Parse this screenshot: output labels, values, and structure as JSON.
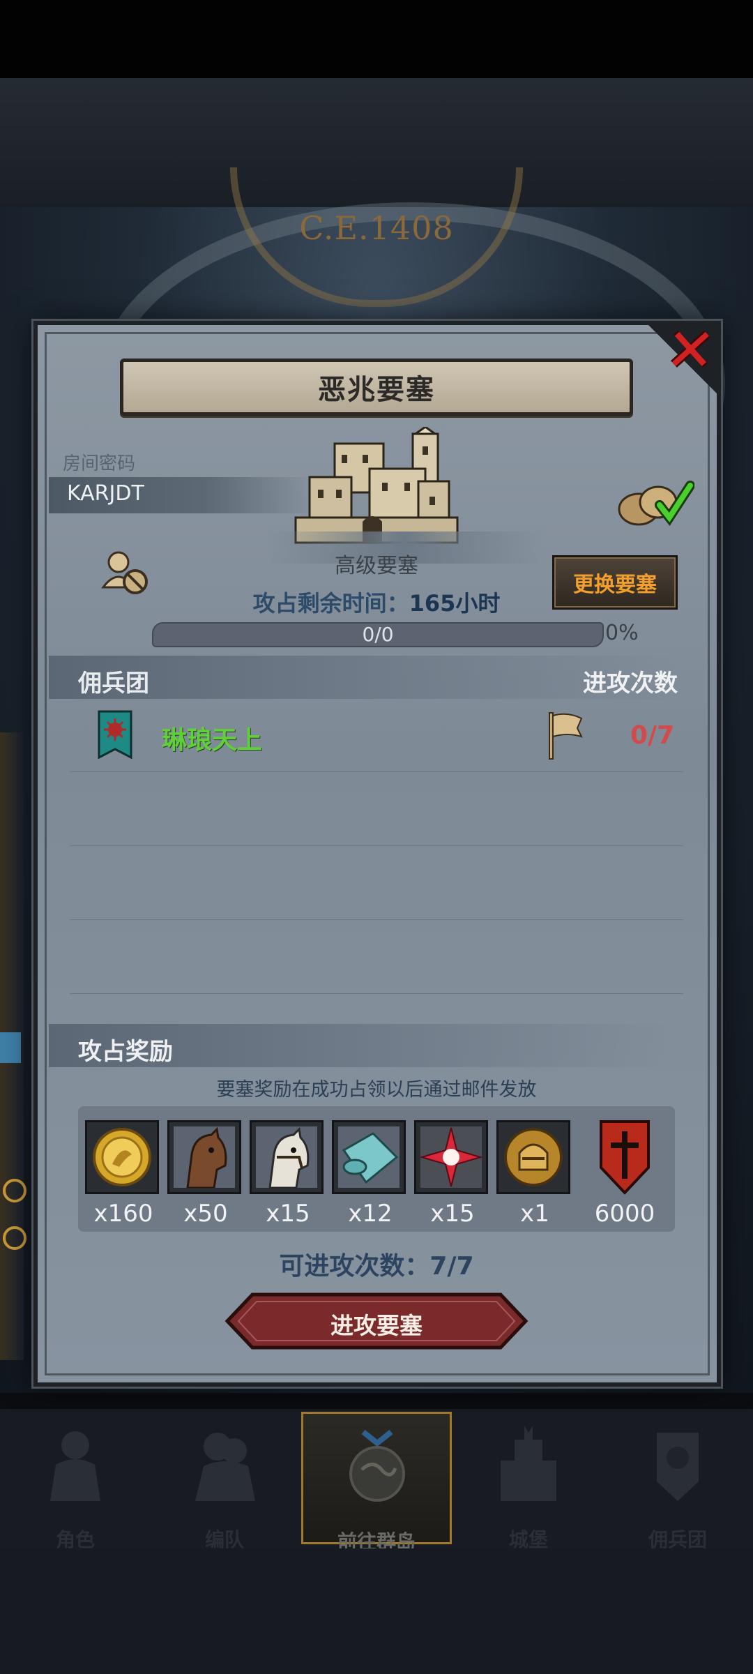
{
  "background": {
    "era_label": "C.E.1408"
  },
  "dialog": {
    "title": "恶兆要塞",
    "room_password_label": "房间密码",
    "room_password": "KARJDT",
    "fortress_level": "高级要塞",
    "change_fortress_button": "更换要塞",
    "occupation_time_label": "攻占剩余时间：",
    "occupation_time_value": "165小时",
    "progress": {
      "text": "0/0",
      "percent_label": "0%",
      "fraction": 0
    },
    "mercenary_header": "佣兵团",
    "attack_count_header": "进攻次数",
    "guild": {
      "name": "琳琅天上",
      "attacks": "0/7"
    },
    "rewards_header": "攻占奖励",
    "rewards_note": "要塞奖励在成功占领以后通过邮件发放",
    "rewards": [
      {
        "icon": "gold-coin-icon",
        "qty": "x160"
      },
      {
        "icon": "brown-horse-icon",
        "qty": "x50"
      },
      {
        "icon": "white-horse-icon",
        "qty": "x15"
      },
      {
        "icon": "cloth-roll-icon",
        "qty": "x12"
      },
      {
        "icon": "red-star-icon",
        "qty": "x15"
      },
      {
        "icon": "knight-helmet-coin-icon",
        "qty": "x1"
      },
      {
        "icon": "guild-crest-icon",
        "qty": "6000"
      }
    ],
    "attempts_text": "可进攻次数：7/7",
    "attack_button": "进攻要塞"
  },
  "bottom_nav": [
    {
      "label": "角色",
      "icon": "knight-icon"
    },
    {
      "label": "编队",
      "icon": "formation-icon"
    },
    {
      "label": "前往群岛",
      "icon": "globe-icon",
      "active": true
    },
    {
      "label": "城堡",
      "icon": "castle-icon"
    },
    {
      "label": "佣兵团",
      "icon": "mercenary-icon"
    }
  ],
  "colors": {
    "guild_name": "#5fcf3a",
    "attack_count": "#d24a4a",
    "change_button_text": "#f2a02a",
    "close_x": "#d02222",
    "active_nav_border": "#a07a2a"
  }
}
